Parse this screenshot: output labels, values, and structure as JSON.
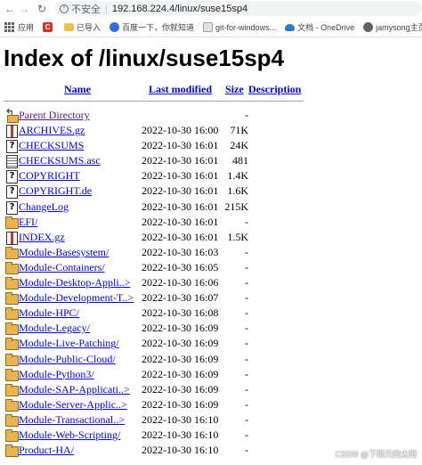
{
  "browser": {
    "insecure_label": "不安全",
    "url": "192.168.224.4/linux/suse15sp4",
    "bookmarks": [
      {
        "label": "应用",
        "icon": "apps-icon"
      },
      {
        "label": "",
        "icon": "red-c-icon"
      },
      {
        "label": "已导入",
        "icon": "folder-icon"
      },
      {
        "label": "百度一下，你就知道",
        "icon": "baidu-icon"
      },
      {
        "label": "git-for-windows...",
        "icon": "page-icon"
      },
      {
        "label": "文档 - OneDrive",
        "icon": "onedrive-icon"
      },
      {
        "label": "jamysong主页",
        "icon": "globe-icon"
      }
    ]
  },
  "page": {
    "title": "Index of /linux/suse15sp4",
    "columns": {
      "name": "Name",
      "last_modified": "Last modified",
      "size": "Size",
      "description": "Description"
    },
    "rows": [
      {
        "icon": "back",
        "name": "Parent Directory",
        "modified": "",
        "size": "-",
        "visited": true
      },
      {
        "icon": "cmp",
        "name": "ARCHIVES.gz",
        "modified": "2022-10-30 16:00",
        "size": "71K"
      },
      {
        "icon": "unk",
        "name": "CHECKSUMS",
        "modified": "2022-10-30 16:01",
        "size": "24K"
      },
      {
        "icon": "txt",
        "name": "CHECKSUMS.asc",
        "modified": "2022-10-30 16:01",
        "size": "481"
      },
      {
        "icon": "unk",
        "name": "COPYRIGHT",
        "modified": "2022-10-30 16:01",
        "size": "1.4K"
      },
      {
        "icon": "unk",
        "name": "COPYRIGHT.de",
        "modified": "2022-10-30 16:01",
        "size": "1.6K"
      },
      {
        "icon": "unk",
        "name": "ChangeLog",
        "modified": "2022-10-30 16:01",
        "size": "215K"
      },
      {
        "icon": "dir",
        "name": "EFI/",
        "modified": "2022-10-30 16:01",
        "size": "-"
      },
      {
        "icon": "cmp",
        "name": "INDEX.gz",
        "modified": "2022-10-30 16:01",
        "size": "1.5K"
      },
      {
        "icon": "dir",
        "name": "Module-Basesystem/",
        "modified": "2022-10-30 16:03",
        "size": "-"
      },
      {
        "icon": "dir",
        "name": "Module-Containers/",
        "modified": "2022-10-30 16:05",
        "size": "-"
      },
      {
        "icon": "dir",
        "name": "Module-Desktop-Appli..>",
        "modified": "2022-10-30 16:06",
        "size": "-"
      },
      {
        "icon": "dir",
        "name": "Module-Development-T..>",
        "modified": "2022-10-30 16:07",
        "size": "-"
      },
      {
        "icon": "dir",
        "name": "Module-HPC/",
        "modified": "2022-10-30 16:08",
        "size": "-"
      },
      {
        "icon": "dir",
        "name": "Module-Legacy/",
        "modified": "2022-10-30 16:09",
        "size": "-"
      },
      {
        "icon": "dir",
        "name": "Module-Live-Patching/",
        "modified": "2022-10-30 16:09",
        "size": "-"
      },
      {
        "icon": "dir",
        "name": "Module-Public-Cloud/",
        "modified": "2022-10-30 16:09",
        "size": "-"
      },
      {
        "icon": "dir",
        "name": "Module-Python3/",
        "modified": "2022-10-30 16:09",
        "size": "-"
      },
      {
        "icon": "dir",
        "name": "Module-SAP-Applicati..>",
        "modified": "2022-10-30 16:09",
        "size": "-"
      },
      {
        "icon": "dir",
        "name": "Module-Server-Applic..>",
        "modified": "2022-10-30 16:09",
        "size": "-"
      },
      {
        "icon": "dir",
        "name": "Module-Transactional..>",
        "modified": "2022-10-30 16:10",
        "size": "-"
      },
      {
        "icon": "dir",
        "name": "Module-Web-Scripting/",
        "modified": "2022-10-30 16:10",
        "size": "-"
      },
      {
        "icon": "dir",
        "name": "Product-HA/",
        "modified": "2022-10-30 16:10",
        "size": "-"
      }
    ]
  },
  "watermark": "CSDN @下雨天的太阳"
}
